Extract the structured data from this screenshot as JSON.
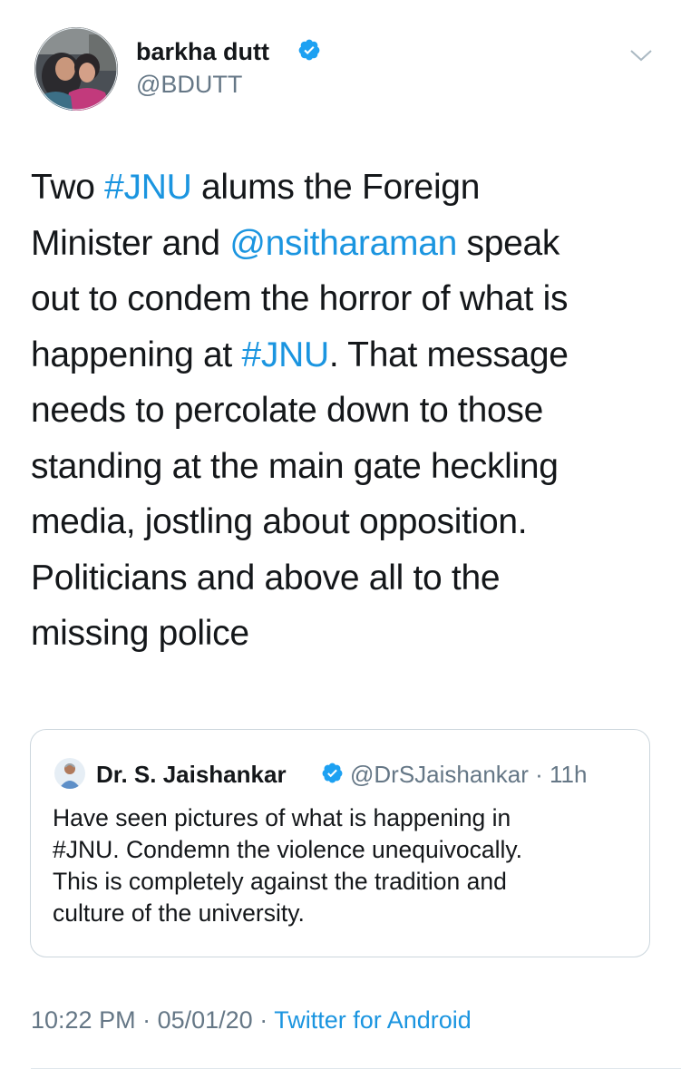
{
  "author": {
    "name": "barkha dutt",
    "handle": "@BDUTT",
    "verified_icon": "verified-badge",
    "avatar_icon": "profile-photo"
  },
  "menu": {
    "icon": "chevron-down-icon"
  },
  "tweet": {
    "lines": [
      [
        {
          "t": "Two "
        },
        {
          "t": "#JNU",
          "link": true
        },
        {
          "t": " alums the Foreign"
        }
      ],
      [
        {
          "t": "Minister and "
        },
        {
          "t": "@nsitharaman",
          "link": true
        },
        {
          "t": " speak"
        }
      ],
      [
        {
          "t": "out to condem the horror of what is"
        }
      ],
      [
        {
          "t": "happening at "
        },
        {
          "t": "#JNU",
          "link": true
        },
        {
          "t": ". That message"
        }
      ],
      [
        {
          "t": "needs to percolate down to those"
        }
      ],
      [
        {
          "t": "standing at the main gate heckling"
        }
      ],
      [
        {
          "t": "media, jostling about opposition."
        }
      ],
      [
        {
          "t": "Politicians and above all to the"
        }
      ],
      [
        {
          "t": "missing police"
        }
      ]
    ]
  },
  "quoted_tweet": {
    "name": "Dr. S. Jaishankar",
    "handle_time": "@DrSJaishankar · 11h",
    "lines": [
      "Have seen pictures of what is happening in",
      "#JNU. Condemn the violence unequivocally.",
      "This is completely against the tradition and",
      "culture of the university."
    ]
  },
  "meta": {
    "time": "10:22 PM",
    "separator": " · ",
    "date": "05/01/20",
    "source": "Twitter for Android"
  },
  "colors": {
    "link": "#1b95e0",
    "secondary_text": "#657786",
    "primary_text": "#14171a",
    "border": "#ccd6dd"
  }
}
